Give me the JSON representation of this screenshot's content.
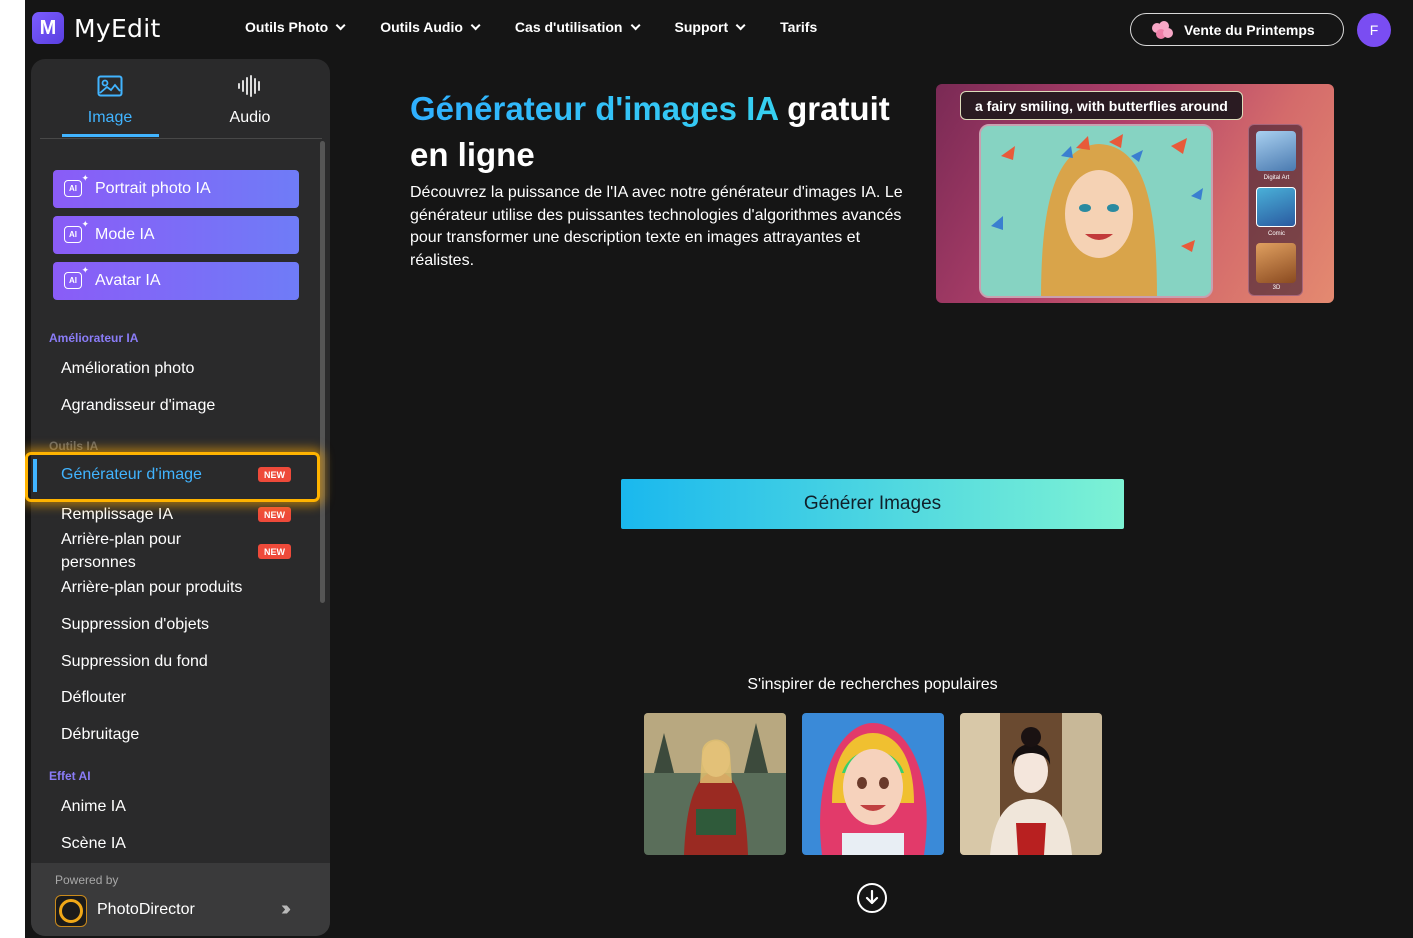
{
  "header": {
    "logo_mark": "M",
    "logo_text": "MyEdit",
    "nav": [
      "Outils Photo",
      "Outils Audio",
      "Cas d'utilisation",
      "Support",
      "Tarifs"
    ],
    "promo_label": "Vente du Printemps",
    "user_initial": "F"
  },
  "sidebar": {
    "tabs": [
      {
        "label": "Image",
        "icon": "image-icon",
        "active": true
      },
      {
        "label": "Audio",
        "icon": "audio-wave-icon",
        "active": false
      }
    ],
    "ai_buttons": [
      "Portrait photo IA",
      "Mode IA",
      "Avatar IA"
    ],
    "ai_icon_text": "AI",
    "sections": {
      "enhancer": "Améliorateur IA",
      "tools": "Outils IA",
      "effects": "Effet AI"
    },
    "enhancer_items": [
      "Amélioration photo",
      "Agrandisseur d'image"
    ],
    "tool_items": [
      {
        "label": "Générateur d'image",
        "badge": "NEW",
        "active": true
      },
      {
        "label": "Remplissage IA",
        "badge": "NEW"
      },
      {
        "label": "Arrière-plan pour personnes",
        "badge": "NEW"
      },
      {
        "label": "Arrière-plan pour produits"
      },
      {
        "label": "Suppression d'objets"
      },
      {
        "label": "Suppression du fond"
      },
      {
        "label": "Déflouter"
      },
      {
        "label": "Débruitage"
      }
    ],
    "effect_items": [
      "Anime IA",
      "Scène IA"
    ],
    "powered_by": "Powered by",
    "powered_app": "PhotoDirector"
  },
  "main": {
    "title_colored": "Générateur d'images IA",
    "title_rest": " gratuit en ligne",
    "description": "Découvrez la puissance de l'IA avec notre générateur d'images IA. Le générateur utilise des puissantes technologies d'algorithmes avancés pour transformer une description texte en images attrayantes et réalistes.",
    "hero_prompt": "a fairy smiling, with butterflies around",
    "styles": [
      "Digital Art",
      "Comic",
      "3D"
    ],
    "generate_button": "Générer Images",
    "inspire_label": "S'inspirer de recherches populaires"
  },
  "colors": {
    "accent_blue": "#41b4ff",
    "ai_purple": "#8a5cf7",
    "badge_red": "#ee4a3a",
    "highlight_orange": "#ffb300"
  }
}
